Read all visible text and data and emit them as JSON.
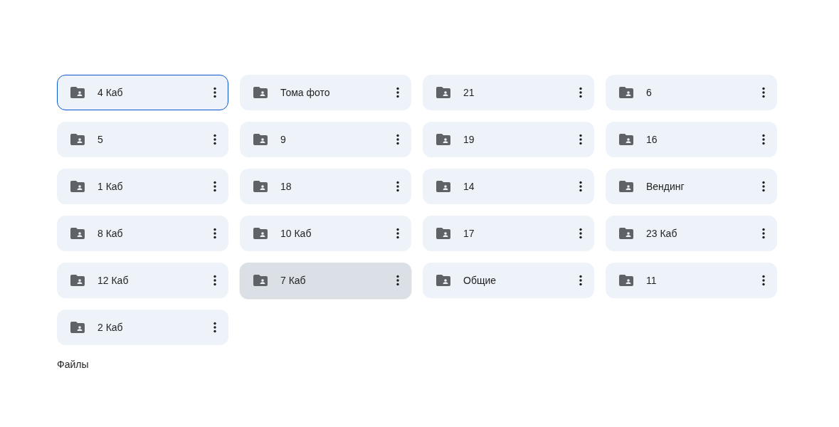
{
  "folders": [
    {
      "name": "4 Каб",
      "selected": true,
      "hovered": false
    },
    {
      "name": "Тома фото",
      "selected": false,
      "hovered": false
    },
    {
      "name": "21",
      "selected": false,
      "hovered": false
    },
    {
      "name": "6",
      "selected": false,
      "hovered": false
    },
    {
      "name": "5",
      "selected": false,
      "hovered": false
    },
    {
      "name": "9",
      "selected": false,
      "hovered": false
    },
    {
      "name": "19",
      "selected": false,
      "hovered": false
    },
    {
      "name": "16",
      "selected": false,
      "hovered": false
    },
    {
      "name": "1 Каб",
      "selected": false,
      "hovered": false
    },
    {
      "name": "18",
      "selected": false,
      "hovered": false
    },
    {
      "name": "14",
      "selected": false,
      "hovered": false
    },
    {
      "name": "Вендинг",
      "selected": false,
      "hovered": false
    },
    {
      "name": "8 Каб",
      "selected": false,
      "hovered": false
    },
    {
      "name": "10 Каб",
      "selected": false,
      "hovered": false
    },
    {
      "name": "17",
      "selected": false,
      "hovered": false
    },
    {
      "name": "23 Каб",
      "selected": false,
      "hovered": false
    },
    {
      "name": "12 Каб",
      "selected": false,
      "hovered": false
    },
    {
      "name": "7 Каб",
      "selected": false,
      "hovered": true
    },
    {
      "name": "Общие",
      "selected": false,
      "hovered": false
    },
    {
      "name": "11",
      "selected": false,
      "hovered": false
    },
    {
      "name": "2 Каб",
      "selected": false,
      "hovered": false
    }
  ],
  "section_heading": "Файлы"
}
